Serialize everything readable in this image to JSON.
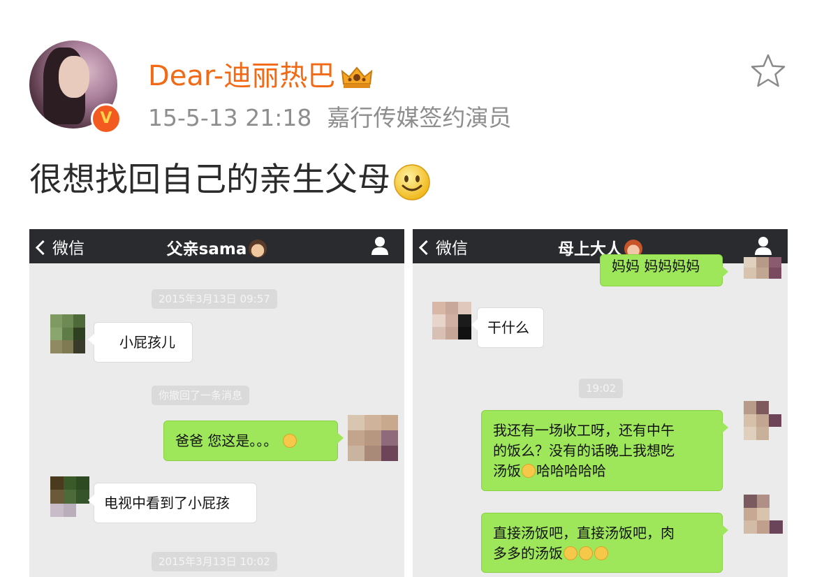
{
  "post": {
    "username": "Dear-迪丽热巴",
    "timestamp": "15-5-13 21:18",
    "source": "嘉行传媒签约演员",
    "text": "很想找回自己的亲生父母",
    "verified_badge": "V"
  },
  "left_chat": {
    "back_label": "微信",
    "title": "父亲sama",
    "messages": [
      {
        "type": "timestamp",
        "text": "2015年3月13日 09:57"
      },
      {
        "type": "incoming",
        "text": "小屁孩儿"
      },
      {
        "type": "system",
        "text": "你撤回了一条消息"
      },
      {
        "type": "outgoing",
        "text": "爸爸 您这是。。。"
      },
      {
        "type": "incoming",
        "text": "电视中看到了小屁孩"
      },
      {
        "type": "timestamp",
        "text": "2015年3月13日 10:02"
      }
    ]
  },
  "right_chat": {
    "back_label": "微信",
    "title": "母上大人",
    "messages": [
      {
        "type": "outgoing",
        "text": "妈妈 妈妈妈妈"
      },
      {
        "type": "incoming",
        "text": "干什么"
      },
      {
        "type": "timestamp",
        "text": "19:02"
      },
      {
        "type": "outgoing",
        "lines": [
          "我还有一场收工呀，还有中午",
          "的饭么？没有的话晚上我想吃",
          "汤饭",
          "哈哈哈哈哈"
        ]
      },
      {
        "type": "outgoing",
        "lines": [
          "直接汤饭吧，直接汤饭吧，肉",
          "多多的汤饭"
        ]
      }
    ]
  },
  "icons": [
    "star-icon",
    "crown-icon",
    "smiley-icon",
    "person-icon",
    "back-chevron-icon"
  ],
  "colors": {
    "username": "#f26a15",
    "badge": "#f25a1f",
    "green_bubble": "#9fe75a",
    "topbar": "#2a2b2f"
  }
}
